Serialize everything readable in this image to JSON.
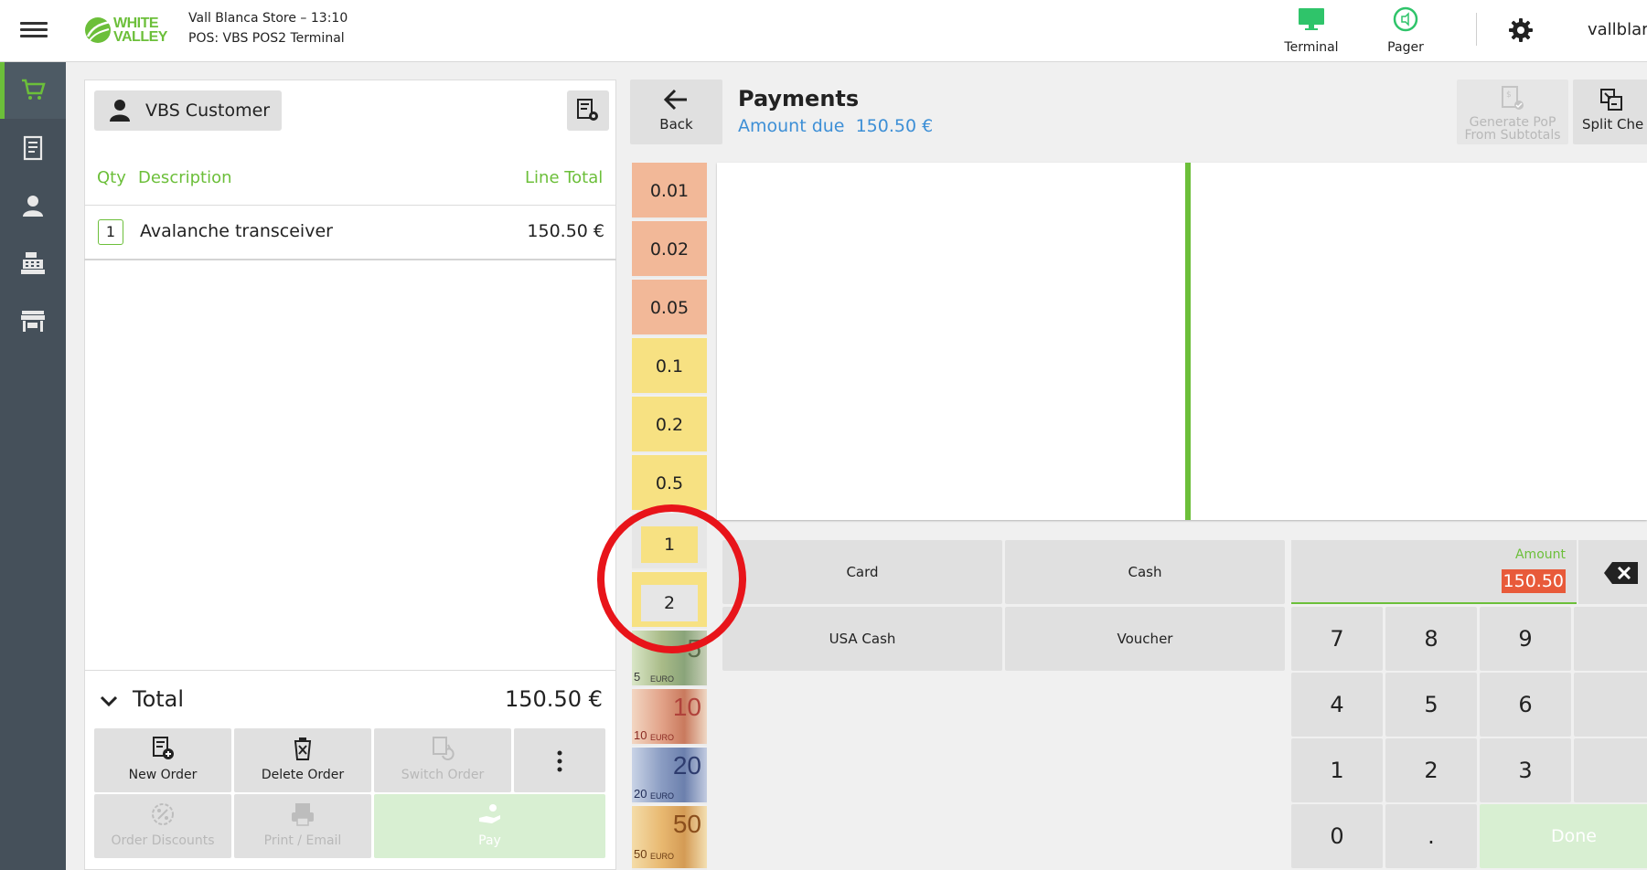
{
  "topbar": {
    "store_line": "Vall Blanca Store – 13:10",
    "pos_line": "POS: VBS POS2 Terminal",
    "logo_line1": "WHITE",
    "logo_line2": "VALLEY",
    "terminal_label": "Terminal",
    "pager_label": "Pager",
    "username": "vallblar",
    "accent_color": "#6cbf3a"
  },
  "sidebar": {
    "items": [
      "cart-icon",
      "receipt-icon",
      "user-icon",
      "cash-register-icon",
      "store-icon"
    ]
  },
  "order": {
    "customer": "VBS Customer",
    "columns": {
      "qty": "Qty",
      "description": "Description",
      "line_total": "Line Total"
    },
    "lines": [
      {
        "qty": "1",
        "description": "Avalanche transceiver",
        "total": "150.50 €"
      }
    ],
    "total_label": "Total",
    "total_value": "150.50 €",
    "actions": {
      "new_order": "New Order",
      "delete_order": "Delete Order",
      "switch_order": "Switch Order",
      "order_discounts": "Order Discounts",
      "print_email": "Print / Email",
      "pay": "Pay"
    }
  },
  "payments": {
    "back_label": "Back",
    "title": "Payments",
    "amount_due_label": "Amount due",
    "amount_due_value": "150.50 €",
    "generate_pop_line1": "Generate PoP",
    "generate_pop_line2": "From Subtotals",
    "split_label": "Split Che",
    "coins": [
      "0.01",
      "0.02",
      "0.05",
      "0.1",
      "0.2",
      "0.5",
      "1",
      "2"
    ],
    "notes": [
      {
        "value": "5",
        "euro": "EURO"
      },
      {
        "value": "10",
        "euro": "EURO"
      },
      {
        "value": "20",
        "euro": "EURO"
      },
      {
        "value": "50",
        "euro": "EURO"
      }
    ],
    "methods": [
      "Card",
      "Cash",
      "USA Cash",
      "Voucher"
    ],
    "amount_label": "Amount",
    "amount_value": "150.50",
    "keypad": [
      "7",
      "8",
      "9",
      "4",
      "5",
      "6",
      "1",
      "2",
      "3",
      "0",
      "."
    ],
    "done_label": "Done"
  }
}
